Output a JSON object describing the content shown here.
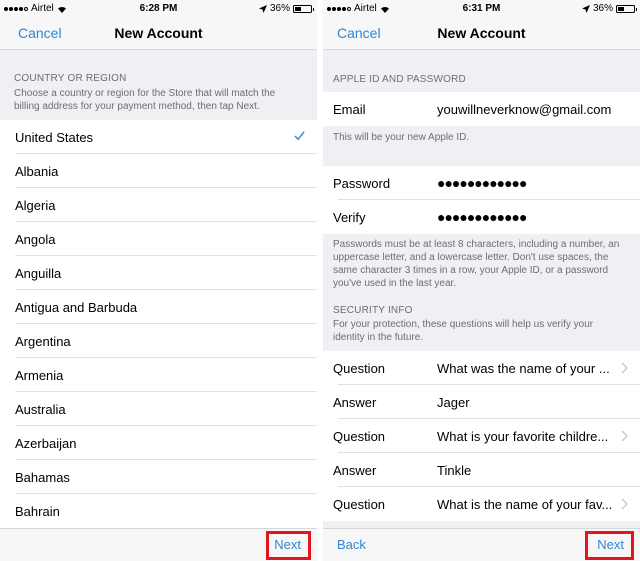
{
  "colors": {
    "accent": "#2f86d3",
    "highlight": "#e5151f",
    "background": "#efeff4"
  },
  "left_screen": {
    "status_bar": {
      "carrier": "Airtel",
      "time": "6:28 PM",
      "battery": "36%",
      "signal_bars": 4,
      "location_icon": "location-arrow-icon",
      "wifi_icon": "wifi-icon",
      "battery_icon": "battery-icon",
      "battery_level": 0.36
    },
    "nav": {
      "cancel": "Cancel",
      "title": "New Account"
    },
    "section_header": "COUNTRY OR REGION",
    "section_desc": "Choose a country or region for the Store that will match the billing address for your payment method, then tap Next.",
    "countries": [
      {
        "name": "United States",
        "selected": true
      },
      {
        "name": "Albania",
        "selected": false
      },
      {
        "name": "Algeria",
        "selected": false
      },
      {
        "name": "Angola",
        "selected": false
      },
      {
        "name": "Anguilla",
        "selected": false
      },
      {
        "name": "Antigua and Barbuda",
        "selected": false
      },
      {
        "name": "Argentina",
        "selected": false
      },
      {
        "name": "Armenia",
        "selected": false
      },
      {
        "name": "Australia",
        "selected": false
      },
      {
        "name": "Azerbaijan",
        "selected": false
      },
      {
        "name": "Bahamas",
        "selected": false
      },
      {
        "name": "Bahrain",
        "selected": false
      }
    ],
    "toolbar": {
      "next": "Next"
    }
  },
  "right_screen": {
    "status_bar": {
      "carrier": "Airtel",
      "time": "6:31 PM",
      "battery": "36%",
      "signal_bars": 4,
      "battery_level": 0.36
    },
    "nav": {
      "cancel": "Cancel",
      "title": "New Account"
    },
    "apple_id_header": "APPLE ID AND PASSWORD",
    "email": {
      "label": "Email",
      "value": "youwillneverknow@gmail.com"
    },
    "email_note": "This will be your new Apple ID.",
    "password": {
      "label": "Password",
      "value": "●●●●●●●●●●●●"
    },
    "verify": {
      "label": "Verify",
      "value": "●●●●●●●●●●●●"
    },
    "password_note": "Passwords must be at least 8 characters, including a number, an uppercase letter, and a lowercase letter. Don't use spaces, the same character 3 times in a row, your Apple ID, or a password you've used in the last year.",
    "security_header": "SECURITY INFO",
    "security_desc": "For your protection, these questions will help us verify your identity in the future.",
    "security_rows": [
      {
        "label": "Question",
        "value": "What was the name of your ...",
        "chevron": true
      },
      {
        "label": "Answer",
        "value": "Jager",
        "chevron": false
      },
      {
        "label": "Question",
        "value": "What is your favorite childre...",
        "chevron": true
      },
      {
        "label": "Answer",
        "value": "Tinkle",
        "chevron": false
      },
      {
        "label": "Question",
        "value": "What is the name of your fav...",
        "chevron": true
      }
    ],
    "toolbar": {
      "back": "Back",
      "next": "Next"
    }
  }
}
